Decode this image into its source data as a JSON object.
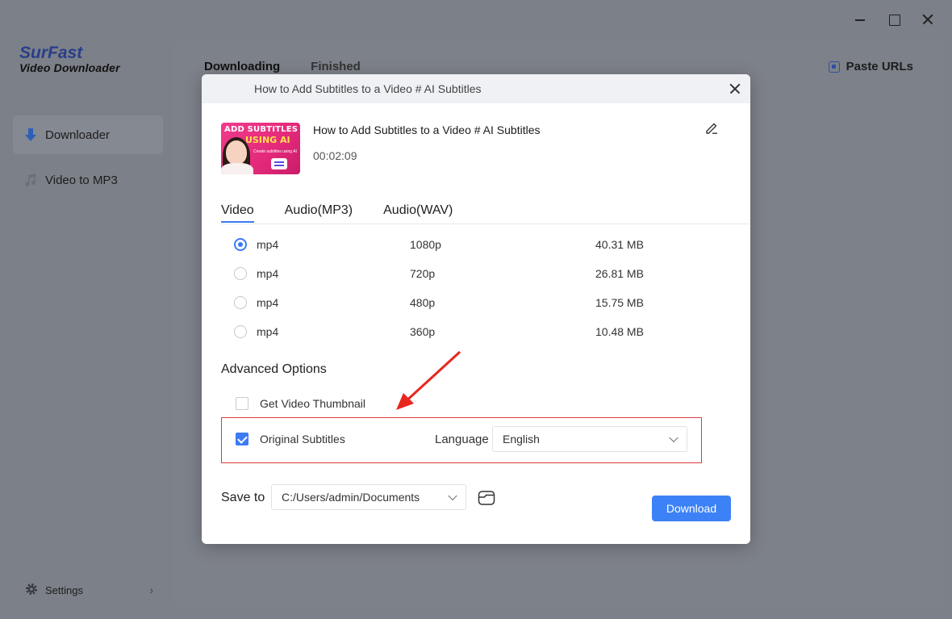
{
  "app": {
    "logo_line1": "SurFast",
    "logo_line2": "Video Downloader"
  },
  "sidebar": {
    "items": [
      {
        "label": "Downloader",
        "icon": "download-arrow-icon",
        "active": true
      },
      {
        "label": "Video to MP3",
        "icon": "music-note-icon",
        "active": false
      }
    ],
    "settings_label": "Settings"
  },
  "main": {
    "tabs": [
      {
        "label": "Downloading"
      },
      {
        "label": "Finished"
      }
    ],
    "paste_urls_label": "Paste URLs"
  },
  "dialog": {
    "header_title": "How to Add Subtitles to a Video # AI Subtitles",
    "video_title": "How to Add Subtitles to a Video # AI Subtitles",
    "duration": "00:02:09",
    "thumbnail_text_1": "ADD SUBTITLES",
    "thumbnail_text_2": "USING AI",
    "thumbnail_text_3": "Create subtitles using AI",
    "format_tabs": [
      {
        "label": "Video",
        "active": true
      },
      {
        "label": "Audio(MP3)",
        "active": false
      },
      {
        "label": "Audio(WAV)",
        "active": false
      }
    ],
    "options": [
      {
        "format": "mp4",
        "resolution": "1080p",
        "size": "40.31 MB",
        "selected": true
      },
      {
        "format": "mp4",
        "resolution": "720p",
        "size": "26.81 MB",
        "selected": false
      },
      {
        "format": "mp4",
        "resolution": "480p",
        "size": "15.75 MB",
        "selected": false
      },
      {
        "format": "mp4",
        "resolution": "360p",
        "size": "10.48 MB",
        "selected": false
      }
    ],
    "advanced_title": "Advanced Options",
    "thumbnail_option": {
      "label": "Get Video Thumbnail",
      "checked": false
    },
    "subtitles_option": {
      "label": "Original Subtitles",
      "checked": true
    },
    "language_label": "Language",
    "language_value": "English",
    "save_to_label": "Save to",
    "save_path": "C:/Users/admin/Documents",
    "download_label": "Download"
  },
  "colors": {
    "accent": "#3c82f6",
    "highlight_box": "#e03a3a",
    "annotation_arrow": "#e8261f",
    "logo_blue": "#2a3e8a"
  }
}
